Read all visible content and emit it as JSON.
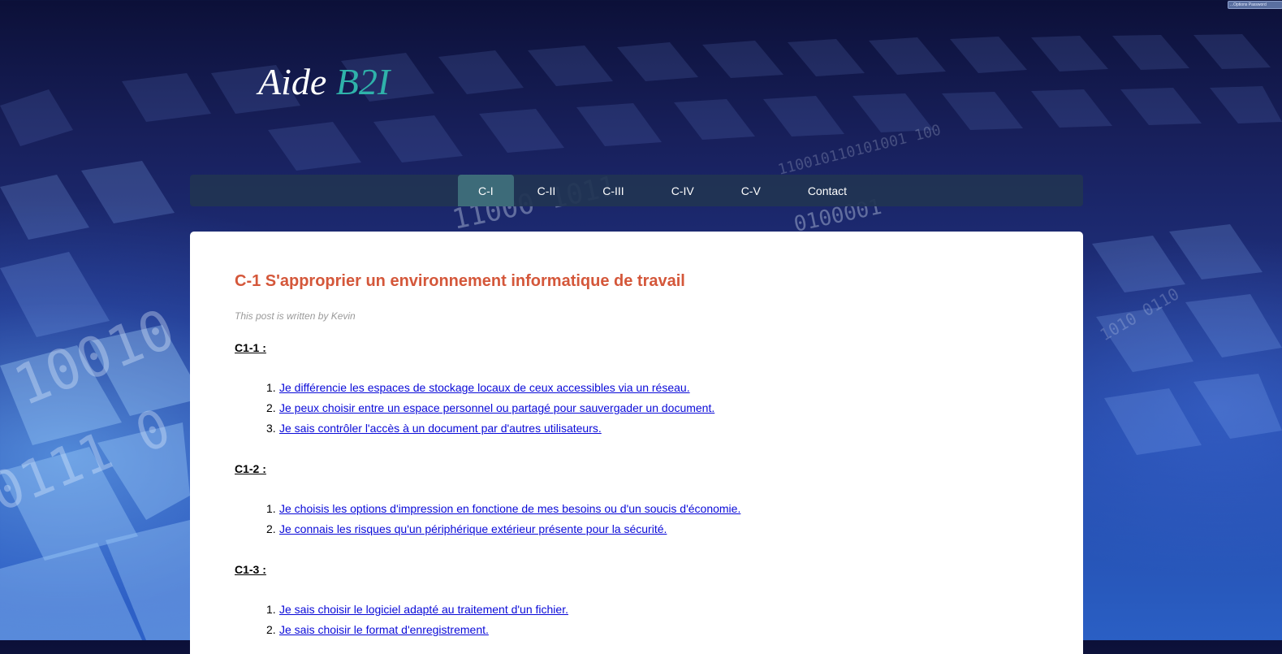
{
  "extension_badge": "...Options  Password",
  "site": {
    "logo_main": "Aide",
    "logo_accent": "B2I"
  },
  "nav": {
    "items": [
      {
        "label": "C-I",
        "active": true
      },
      {
        "label": "C-II",
        "active": false
      },
      {
        "label": "C-III",
        "active": false
      },
      {
        "label": "C-IV",
        "active": false
      },
      {
        "label": "C-V",
        "active": false
      },
      {
        "label": "Contact",
        "active": false
      }
    ]
  },
  "post": {
    "title": "C-1 S'approprier un environnement informatique de travail",
    "byline": "This post is written by Kevin",
    "sections": [
      {
        "heading": "C1-1 :",
        "items": [
          {
            "n": "1.",
            "text": "Je différencie les espaces de stockage locaux de ceux accessibles via un réseau."
          },
          {
            "n": "2.",
            "text": "Je peux choisir entre un espace personnel ou partagé pour sauvergader un document."
          },
          {
            "n": "3.",
            "text": "Je sais contrôler l'accès à un document par d'autres utilisateurs."
          }
        ]
      },
      {
        "heading": "C1-2 :",
        "items": [
          {
            "n": "1.",
            "text": "Je choisis les options d'impression en fonctione de mes besoins ou d'un soucis d'économie."
          },
          {
            "n": "2.",
            "text": "Je connais les risques qu'un périphérique extérieur présente pour la sécurité."
          }
        ]
      },
      {
        "heading": "C1-3 :",
        "items": [
          {
            "n": "1.",
            "text": "Je sais choisir le logiciel adapté au traitement d'un fichier."
          },
          {
            "n": "2.",
            "text": "Je sais choisir le format d'enregistrement."
          }
        ]
      }
    ]
  },
  "colors": {
    "title": "#d4573a",
    "logo_accent": "#2fb2aa",
    "nav_bg": "#213453",
    "nav_active": "#3d6b79",
    "link": "#0a0ad8"
  }
}
